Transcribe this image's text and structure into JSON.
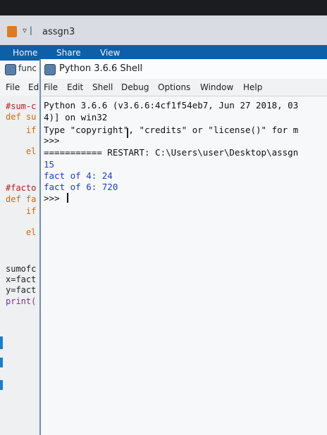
{
  "explorer": {
    "title": "assgn3",
    "qat_symbol": "▿ |",
    "tabs": [
      "Home",
      "Share",
      "View"
    ]
  },
  "editor": {
    "title_partial": "func",
    "menu": [
      "File",
      "Ed"
    ],
    "code": [
      {
        "text": "#sum-c",
        "kind": "comment"
      },
      {
        "text": "def su",
        "kind": "kw"
      },
      {
        "text": "    if",
        "kind": "kw"
      },
      {
        "text": "    el",
        "kind": "kw"
      },
      {
        "text": "#facto",
        "kind": "comment"
      },
      {
        "text": "def fa",
        "kind": "kw"
      },
      {
        "text": "    if",
        "kind": "kw"
      },
      {
        "text": "    el",
        "kind": "kw"
      },
      {
        "text": "sumofc",
        "kind": "plain"
      },
      {
        "text": "x=fact",
        "kind": "plain"
      },
      {
        "text": "y=fact",
        "kind": "plain"
      },
      {
        "text": "print(",
        "kind": "builtin"
      }
    ]
  },
  "shell": {
    "title": "Python 3.6.6 Shell",
    "menu": [
      "File",
      "Edit",
      "Shell",
      "Debug",
      "Options",
      "Window",
      "Help"
    ],
    "lines": [
      {
        "text": "Python 3.6.6 (v3.6.6:4cf1f54eb7, Jun 27 2018, 03",
        "kind": "plain"
      },
      {
        "text": "4)] on win32",
        "kind": "plain"
      },
      {
        "text": "Type \"copyright\", \"credits\" or \"license()\" for m",
        "kind": "plain"
      },
      {
        "text": ">>>",
        "kind": "plain"
      },
      {
        "text": "=========== RESTART: C:\\Users\\user\\Desktop\\assgn",
        "kind": "plain"
      },
      {
        "text": "15",
        "kind": "out"
      },
      {
        "text": "fact of 4: 24",
        "kind": "out"
      },
      {
        "text": "fact of 6: 720",
        "kind": "out"
      },
      {
        "text": ">>> ",
        "kind": "plain"
      }
    ]
  }
}
